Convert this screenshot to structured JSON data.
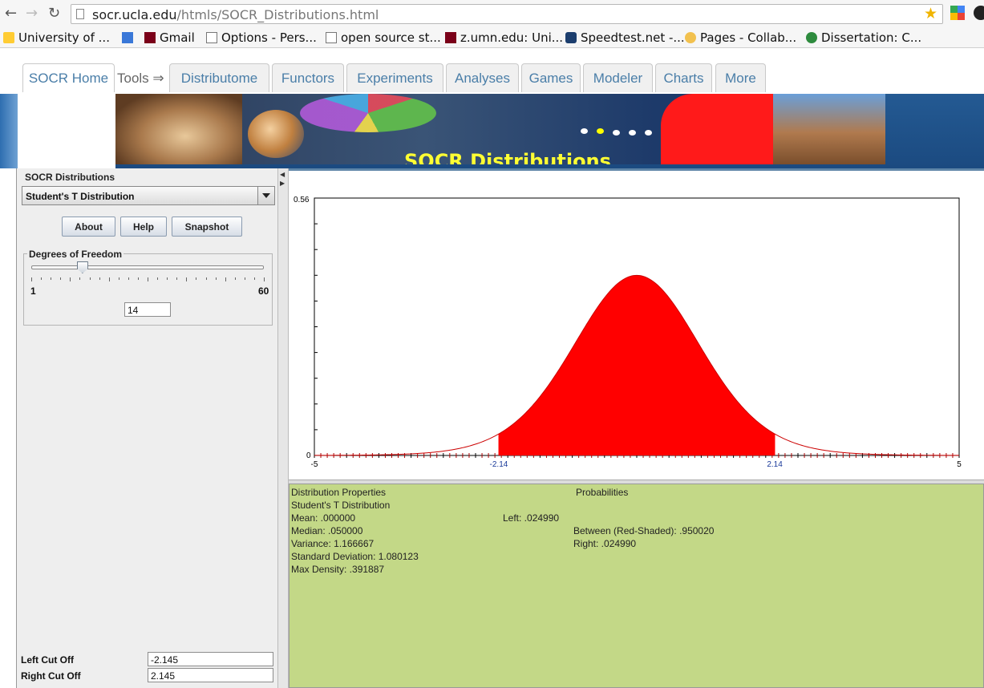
{
  "browser": {
    "url_host": "socr.ucla.edu",
    "url_path": "/htmls/SOCR_Distributions.html",
    "bookmarks": [
      "University of ...",
      "Gmail",
      "Options - Pers...",
      "open source st...",
      "z.umn.edu: Uni...",
      "Speedtest.net -...",
      "Pages - Collab...",
      "Dissertation: C..."
    ]
  },
  "site": {
    "tabs": [
      "SOCR Home",
      "Distributome",
      "Functors",
      "Experiments",
      "Analyses",
      "Games",
      "Modeler",
      "Charts",
      "More"
    ],
    "tools_label": "Tools ⇒",
    "banner_title": "SOCR Distributions"
  },
  "left_panel": {
    "group_title": "SOCR Distributions",
    "distribution_selected": "Student's T Distribution",
    "buttons": {
      "about": "About",
      "help": "Help",
      "snapshot": "Snapshot"
    },
    "parameter": {
      "legend": "Degrees of Freedom",
      "min_label": "1",
      "max_label": "60",
      "value": "14",
      "slider_min": 1,
      "slider_max": 60,
      "slider_value": 14
    },
    "left_cut_label": "Left Cut Off",
    "left_cut_value": "-2.145",
    "right_cut_label": "Right Cut Off",
    "right_cut_value": "2.145"
  },
  "chart_data": {
    "type": "area",
    "distribution": "Student's t",
    "df": 14,
    "xlim": [
      -5,
      5
    ],
    "ylim": [
      0,
      0.56
    ],
    "y_top_label": "0.56",
    "y_bottom_label": "0",
    "x_tick_labels": [
      "-5",
      "-2.14",
      "2.14",
      "5"
    ],
    "x_tick_values": [
      -5,
      -2.14,
      2.14,
      5
    ],
    "shaded_range": [
      -2.145,
      2.145
    ],
    "shade_color": "#ff0000",
    "curve_color": "#cc0000"
  },
  "properties": {
    "header_left": "Distribution Properties",
    "header_right": "Probabilities",
    "name": "Student's T Distribution",
    "mean": "Mean: .000000",
    "median": "Median: .050000",
    "variance": "Variance: 1.166667",
    "std_dev": "Standard Deviation: 1.080123",
    "max_density": "Max Density: .391887",
    "left_prob": "Left: .024990",
    "between_prob": "Between (Red-Shaded): .950020",
    "right_prob": "Right: .024990"
  }
}
